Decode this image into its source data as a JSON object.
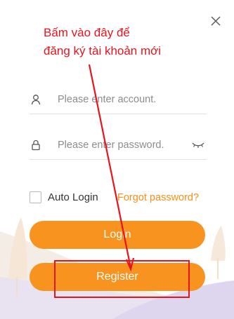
{
  "annotation": {
    "line1": "Bấm vào đây để",
    "line2": "đăng ký tài khoản mới",
    "color": "#e8141d"
  },
  "form": {
    "account": {
      "placeholder": "Please enter account.",
      "value": "",
      "icon": "user-icon"
    },
    "password": {
      "placeholder": "Please enter password.",
      "value": "",
      "icon": "lock-icon",
      "toggle_icon": "eye-closed-icon"
    },
    "auto_login": {
      "label": "Auto Login",
      "checked": false
    },
    "forgot_label": "Forgot password?",
    "login_label": "Login",
    "register_label": "Register"
  },
  "colors": {
    "accent": "#f7931e",
    "link": "#f79016",
    "annotation": "#e8141d"
  },
  "icons": [
    "close-icon",
    "user-icon",
    "lock-icon",
    "eye-closed-icon"
  ]
}
